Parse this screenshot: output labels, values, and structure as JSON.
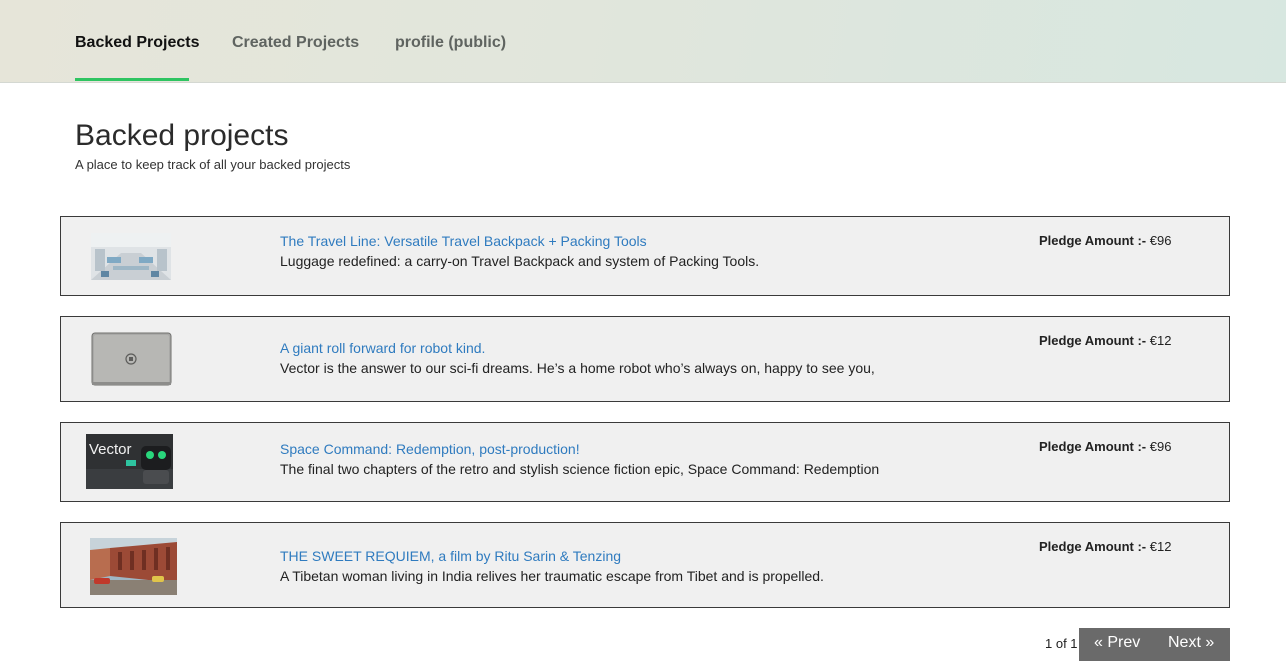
{
  "nav": {
    "tabs": [
      {
        "label": "Backed Projects",
        "active": true
      },
      {
        "label": "Created Projects",
        "active": false
      },
      {
        "label": "profile (public)",
        "active": false
      }
    ],
    "accent_color": "#2ec461"
  },
  "header": {
    "title": "Backed projects",
    "subtitle": "A place to keep track of all your backed projects"
  },
  "projects": [
    {
      "title": "The Travel Line: Versatile Travel Backpack + Packing Tools",
      "description": "Luggage redefined: a carry-on Travel Backpack and system of Packing Tools.",
      "pledge_label": "Pledge Amount :-",
      "pledge_value": "€96",
      "thumbnail": "office-interior-photo"
    },
    {
      "title": "A giant roll forward for robot kind.",
      "description": "Vector is the answer to our sci-fi dreams. He’s a home robot who’s always on, happy to see you,",
      "pledge_label": "Pledge Amount :-",
      "pledge_value": "€12",
      "thumbnail": "laptop-photo"
    },
    {
      "title": "Space Command: Redemption, post-production!",
      "description": "The final two chapters of the retro and stylish science fiction epic, Space Command: Redemption",
      "pledge_label": "Pledge Amount :-",
      "pledge_value": "€96",
      "thumbnail": "vector-robot-photo",
      "thumbnail_text": "Vector"
    },
    {
      "title": "THE SWEET REQUIEM, a film by Ritu Sarin & Tenzing",
      "description": "A Tibetan woman living in India relives her traumatic escape from Tibet and is propelled.",
      "pledge_label": "Pledge Amount :-",
      "pledge_value": "€12",
      "thumbnail": "street-film-still-photo"
    }
  ],
  "pagination": {
    "status": "1 of 1",
    "prev_label": "« Prev",
    "next_label": "Next »"
  }
}
